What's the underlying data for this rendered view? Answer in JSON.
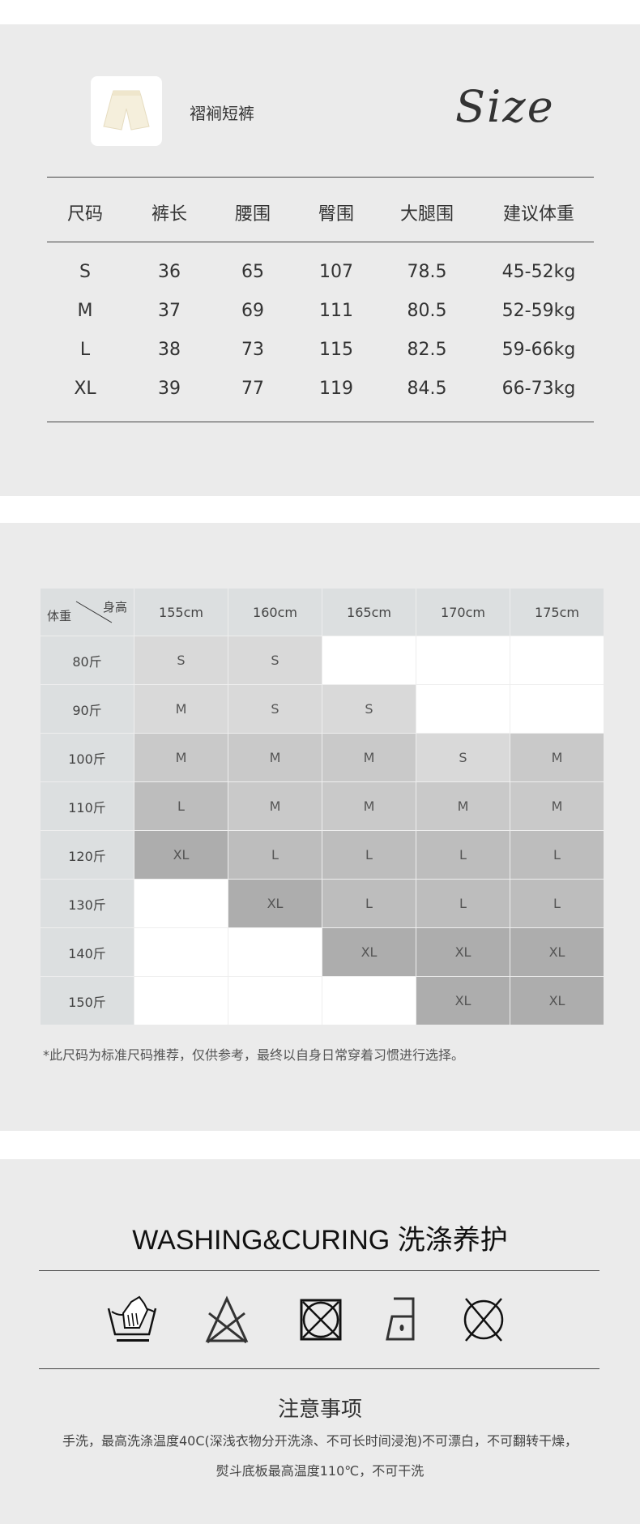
{
  "product": {
    "title": "褶裥短裤",
    "size_word": "Size"
  },
  "size_table": {
    "headers": [
      "尺码",
      "裤长",
      "腰围",
      "臀围",
      "大腿围",
      "建议体重"
    ],
    "rows": [
      [
        "S",
        "36",
        "65",
        "107",
        "78.5",
        "45-52kg"
      ],
      [
        "M",
        "37",
        "69",
        "111",
        "80.5",
        "52-59kg"
      ],
      [
        "L",
        "38",
        "73",
        "115",
        "82.5",
        "59-66kg"
      ],
      [
        "XL",
        "39",
        "77",
        "119",
        "84.5",
        "66-73kg"
      ]
    ]
  },
  "recommend_table": {
    "corner_weight": "体重",
    "corner_height": "身高",
    "heights": [
      "155cm",
      "160cm",
      "165cm",
      "170cm",
      "175cm"
    ],
    "shades": {
      "S": "#d9d9d9",
      "M": "#c9c9c9",
      "L": "#bdbdbd",
      "XL": "#adadad",
      "light": "#d9d9d9",
      "empty": "#ffffff"
    },
    "rows": [
      {
        "weight": "80斤",
        "cells": [
          {
            "v": "S",
            "s": "S"
          },
          {
            "v": "S",
            "s": "S"
          },
          {
            "v": "",
            "s": "empty"
          },
          {
            "v": "",
            "s": "empty"
          },
          {
            "v": "",
            "s": "empty"
          }
        ]
      },
      {
        "weight": "90斤",
        "cells": [
          {
            "v": "M",
            "s": "light"
          },
          {
            "v": "S",
            "s": "S"
          },
          {
            "v": "S",
            "s": "S"
          },
          {
            "v": "",
            "s": "empty"
          },
          {
            "v": "",
            "s": "empty"
          }
        ]
      },
      {
        "weight": "100斤",
        "cells": [
          {
            "v": "M",
            "s": "M"
          },
          {
            "v": "M",
            "s": "M"
          },
          {
            "v": "M",
            "s": "M"
          },
          {
            "v": "S",
            "s": "S"
          },
          {
            "v": "M",
            "s": "M"
          }
        ]
      },
      {
        "weight": "110斤",
        "cells": [
          {
            "v": "L",
            "s": "L"
          },
          {
            "v": "M",
            "s": "M"
          },
          {
            "v": "M",
            "s": "M"
          },
          {
            "v": "M",
            "s": "M"
          },
          {
            "v": "M",
            "s": "M"
          }
        ]
      },
      {
        "weight": "120斤",
        "cells": [
          {
            "v": "XL",
            "s": "XL"
          },
          {
            "v": "L",
            "s": "L"
          },
          {
            "v": "L",
            "s": "L"
          },
          {
            "v": "L",
            "s": "L"
          },
          {
            "v": "L",
            "s": "L"
          }
        ]
      },
      {
        "weight": "130斤",
        "cells": [
          {
            "v": "",
            "s": "empty"
          },
          {
            "v": "XL",
            "s": "XL"
          },
          {
            "v": "L",
            "s": "L"
          },
          {
            "v": "L",
            "s": "L"
          },
          {
            "v": "L",
            "s": "L"
          }
        ]
      },
      {
        "weight": "140斤",
        "cells": [
          {
            "v": "",
            "s": "empty"
          },
          {
            "v": "",
            "s": "empty"
          },
          {
            "v": "XL",
            "s": "XL"
          },
          {
            "v": "XL",
            "s": "XL"
          },
          {
            "v": "XL",
            "s": "XL"
          }
        ]
      },
      {
        "weight": "150斤",
        "cells": [
          {
            "v": "",
            "s": "empty"
          },
          {
            "v": "",
            "s": "empty"
          },
          {
            "v": "",
            "s": "empty"
          },
          {
            "v": "XL",
            "s": "XL"
          },
          {
            "v": "XL",
            "s": "XL"
          }
        ]
      }
    ],
    "note": "*此尺码为标准尺码推荐，仅供参考，最终以自身日常穿着习惯进行选择。"
  },
  "care": {
    "title": "WASHING&CURING 洗涤养护",
    "icons": [
      "hand-wash-icon",
      "no-bleach-icon",
      "no-tumble-dry-icon",
      "iron-low-icon",
      "no-dry-clean-icon"
    ],
    "notes_title": "注意事项",
    "notes_line1": "手洗，最高洗涤温度40C(深浅衣物分开洗涤、不可长时间浸泡)不可漂白，不可翻转干燥，",
    "notes_line2": "熨斗底板最高温度110℃，不可干洗"
  }
}
